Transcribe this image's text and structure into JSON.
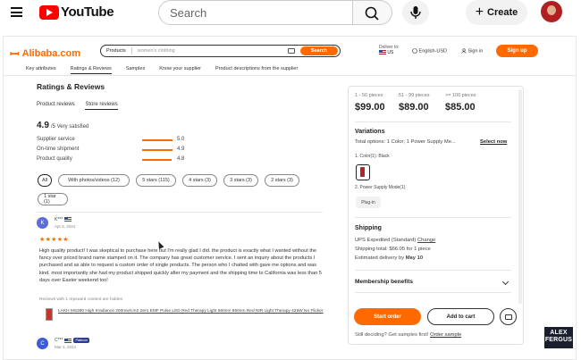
{
  "youtube": {
    "logo": "YouTube",
    "search_placeholder": "Search",
    "create_label": "Create",
    "create_plus": "+"
  },
  "alibaba": {
    "logo": "Alibaba.com",
    "search": {
      "category": "Products",
      "query": "women's clothing",
      "button": "Search"
    },
    "deliver": {
      "label": "Deliver to:",
      "country": "US"
    },
    "language": "English-USD",
    "sign_in": "Sign in",
    "sign_up": "Sign up",
    "nav": [
      {
        "label": "Key attributes"
      },
      {
        "label": "Ratings & Reviews"
      },
      {
        "label": "Samples"
      },
      {
        "label": "Know your supplier"
      },
      {
        "label": "Product descriptions from the supplier"
      }
    ]
  },
  "reviews": {
    "title": "Ratings & Reviews",
    "tabs": [
      {
        "label": "Product reviews"
      },
      {
        "label": "Store reviews"
      }
    ],
    "score": "4.9",
    "score_suffix": "/5 Very satisfied",
    "metrics": [
      {
        "label": "Supplier service",
        "value": "5.0"
      },
      {
        "label": "On-time shipment",
        "value": "4.9"
      },
      {
        "label": "Product quality",
        "value": "4.8"
      }
    ],
    "filters": [
      {
        "label": "All"
      },
      {
        "label": "With photos/videos (12)"
      },
      {
        "label": "5 stars (115)"
      },
      {
        "label": "4 stars (3)"
      },
      {
        "label": "3 stars (3)"
      },
      {
        "label": "2 stars (3)"
      },
      {
        "label": "1 star (1)"
      }
    ],
    "items": [
      {
        "avatar": "K",
        "name": "K***",
        "date": "Apr 6, 2024",
        "stars": "★★★★★",
        "body": "High quality product! I was skeptical to purchase here but I'm really glad I did. the product is exactly what I wanted without the fancy over priced brand name stamped on it. The company has great customer service. I sent an inquiry about the products I purchased and as able to request a custom order of single products. The person who I chatted with gave me options and was kind. most importantly she had my product shipped quickly after my payment and the shipping time to California was less than 5 days over Easter weekend too!",
        "hidden_note": "Reviews with 1 repeated content are hidden",
        "product": "LAKH MS380 High Irradiance 200mw/cm2 Zero EMF Pulse LED Red Therapy Light 660nm 850nm Red NIR Light Therapy 425W No Flicker"
      },
      {
        "avatar": "C",
        "name": "C***",
        "badge": "Platinum",
        "date": "Mar 3, 2024"
      }
    ]
  },
  "purchase": {
    "tiers": [
      {
        "range": "1 - 50 pieces",
        "price": "$99.00"
      },
      {
        "range": "51 - 99 pieces",
        "price": "$89.00"
      },
      {
        "range": ">= 100 pieces",
        "price": "$85.00"
      }
    ],
    "variations_title": "Variations",
    "total_options": "Total options: 1 Color; 1 Power Supply Me...",
    "select_now": "Select now",
    "color_label": "1. Color(1): Black",
    "power_label": "2. Power Supply Mode(1)",
    "power_option": "Plug-in",
    "shipping_title": "Shipping",
    "shipping_method": "UPS Expedited (Standard)",
    "change": "Change",
    "shipping_total": "Shipping total: $66.05 for 1 piece",
    "estimated_prefix": "Estimated delivery by ",
    "estimated_date": "May 10",
    "membership": "Membership benefits",
    "start_order": "Start order",
    "add_to_cart": "Add to cart",
    "samples_prefix": "Still deciding? Get samples first! ",
    "order_sample": "Order sample"
  },
  "watermark": {
    "line1": "ALEX",
    "line2": "FERGUS"
  },
  "colors": {
    "accent": "#ff6a00",
    "youtube_red": "#ff0000"
  }
}
